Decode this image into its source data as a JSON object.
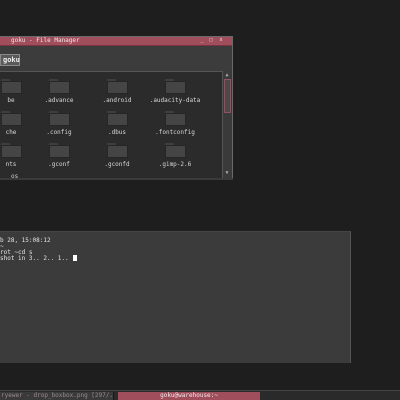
{
  "file_manager": {
    "title": "goku - File Manager",
    "window_buttons": {
      "minimize": "_",
      "maximize": "□",
      "close": "x"
    },
    "location_button": "goku",
    "items": [
      {
        "name": "be"
      },
      {
        "name": ".advance"
      },
      {
        "name": ".android"
      },
      {
        "name": ".audacity-data"
      },
      {
        "name": "che"
      },
      {
        "name": ".config"
      },
      {
        "name": ".dbus"
      },
      {
        "name": ".fontconfig"
      },
      {
        "name": "nts"
      },
      {
        "name": ".gconf"
      },
      {
        "name": ".gconfd"
      },
      {
        "name": ".gimp-2.6"
      }
    ],
    "status": "os",
    "scroll_up": "▲",
    "scroll_down": "▼"
  },
  "terminal": {
    "lines": [
      "b 28, 15:08:12",
      "~",
      "rot ~cd s",
      "shot in 3.. 2.. 1.. "
    ]
  },
  "taskbar": {
    "inactive_task": "ryewer - drop_boxbox.png [297/...",
    "active_task": "goku@warehouse:~"
  },
  "colors": {
    "accent": "#a14e5c",
    "desktop": "#1e1e1e",
    "window_bg": "#3a3a3a",
    "terminal_bg": "#3b3b3b"
  }
}
